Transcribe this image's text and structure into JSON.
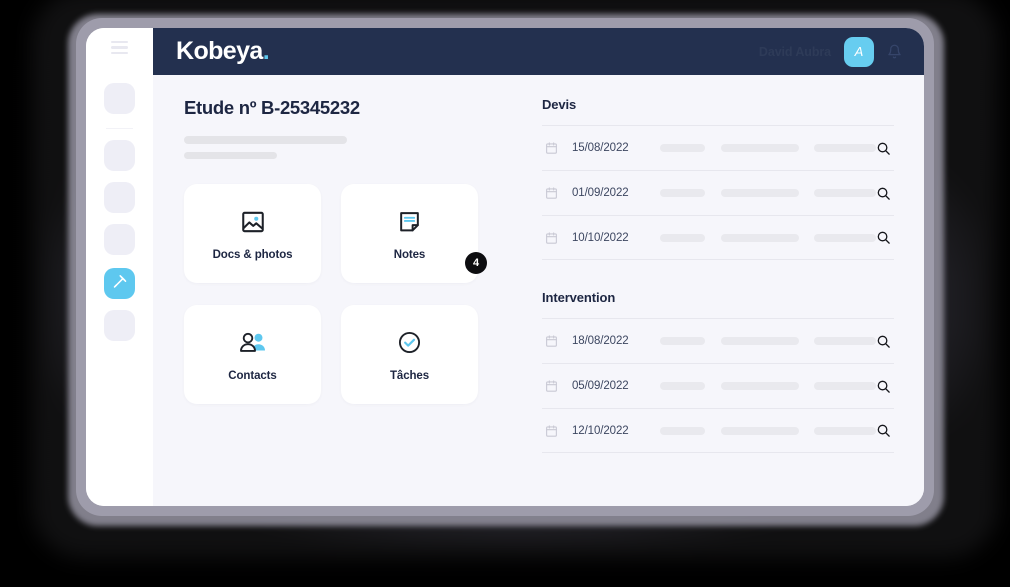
{
  "app": {
    "brand_name": "Kobeya",
    "brand_dot": "."
  },
  "topbar": {
    "user_name": "David Aubra",
    "avatar_initial": "A",
    "bell_icon": "bell-icon",
    "menu_icon": "hamburger-menu-icon"
  },
  "sidebar": {
    "items": [
      {
        "id": "nav-1",
        "icon": "placeholder-icon",
        "active": false
      },
      {
        "id": "nav-2",
        "icon": "placeholder-icon",
        "active": false
      },
      {
        "id": "nav-3",
        "icon": "placeholder-icon",
        "active": false
      },
      {
        "id": "nav-4",
        "icon": "placeholder-icon",
        "active": false
      },
      {
        "id": "nav-5",
        "icon": "hammer-tool-icon",
        "active": true
      },
      {
        "id": "nav-6",
        "icon": "placeholder-icon",
        "active": false
      }
    ]
  },
  "page": {
    "title": "Etude nº B-25345232",
    "subtitle_placeholder_1": "",
    "subtitle_placeholder_2": ""
  },
  "cards": [
    {
      "label": "Docs & photos",
      "icon": "image-photo-icon",
      "badge": null
    },
    {
      "label": "Notes",
      "icon": "note-document-icon",
      "badge": "4"
    },
    {
      "label": "Contacts",
      "icon": "two-people-icon",
      "badge": null
    },
    {
      "label": "Tâches",
      "icon": "check-circle-icon",
      "badge": null
    }
  ],
  "sections": [
    {
      "title": "Devis",
      "rows": [
        {
          "date": "15/08/2022",
          "calendar_icon": "calendar-icon",
          "search_icon": "search-icon"
        },
        {
          "date": "01/09/2022",
          "calendar_icon": "calendar-icon",
          "search_icon": "search-icon"
        },
        {
          "date": "10/10/2022",
          "calendar_icon": "calendar-icon",
          "search_icon": "search-icon"
        }
      ]
    },
    {
      "title": "Intervention",
      "rows": [
        {
          "date": "18/08/2022",
          "calendar_icon": "calendar-icon",
          "search_icon": "search-icon"
        },
        {
          "date": "05/09/2022",
          "calendar_icon": "calendar-icon",
          "search_icon": "search-icon"
        },
        {
          "date": "12/10/2022",
          "calendar_icon": "calendar-icon",
          "search_icon": "search-icon"
        }
      ]
    }
  ],
  "colors": {
    "accent": "#5ec8ef",
    "header_bg": "#23304f",
    "page_bg": "#f6f6fb",
    "text_dark": "#1d2642",
    "badge_bg": "#0d0d10",
    "skeleton": "#e7e7ee"
  }
}
